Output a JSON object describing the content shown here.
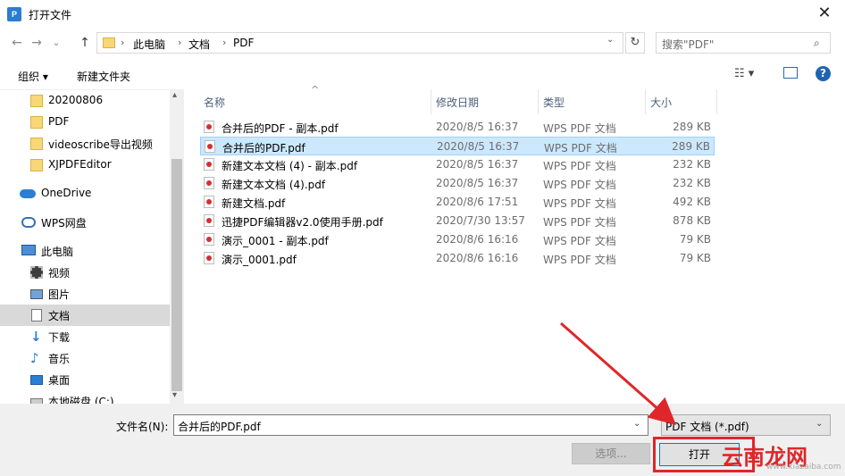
{
  "window": {
    "title": "打开文件",
    "app_icon": "wps-pdf-icon",
    "close_glyph": "✕"
  },
  "nav": {
    "back_glyph": "←",
    "forward_glyph": "→",
    "recent_glyph": "⌄",
    "up_glyph": "↑",
    "breadcrumbs": [
      "此电脑",
      "文档",
      "PDF"
    ],
    "crumb_sep": "›",
    "dropdown_glyph": "⌄",
    "refresh_glyph": "↻",
    "search_placeholder": "搜索\"PDF\"",
    "search_glyph": "⌕"
  },
  "toolbar": {
    "organize": "组织 ▾",
    "new_folder": "新建文件夹",
    "view_glyph": "☷ ▾",
    "help": "?"
  },
  "sidebar": {
    "items": [
      {
        "label": "20200806",
        "icon": "folder-icon"
      },
      {
        "label": "PDF",
        "icon": "folder-icon"
      },
      {
        "label": "videoscribe导出视频",
        "icon": "folder-icon"
      },
      {
        "label": "XJPDFEditor",
        "icon": "folder-icon"
      },
      {
        "label": "OneDrive",
        "icon": "cloud-icon"
      },
      {
        "label": "WPS网盘",
        "icon": "wps-cloud-icon"
      },
      {
        "label": "此电脑",
        "icon": "computer-icon"
      },
      {
        "label": "视频",
        "icon": "video-icon"
      },
      {
        "label": "图片",
        "icon": "picture-icon"
      },
      {
        "label": "文档",
        "icon": "document-icon",
        "selected": true
      },
      {
        "label": "下载",
        "icon": "download-icon"
      },
      {
        "label": "音乐",
        "icon": "music-icon"
      },
      {
        "label": "桌面",
        "icon": "desktop-icon"
      },
      {
        "label": "本地磁盘 (C:)",
        "icon": "drive-icon"
      }
    ],
    "scroll_up": "▴",
    "scroll_down": "▾"
  },
  "columns": {
    "name": "名称",
    "modified": "修改日期",
    "type": "类型",
    "size": "大小",
    "sort_glyph": "^"
  },
  "files": [
    {
      "name": "合并后的PDF - 副本.pdf",
      "modified": "2020/8/5 16:37",
      "type": "WPS PDF 文档",
      "size": "289 KB"
    },
    {
      "name": "合并后的PDF.pdf",
      "modified": "2020/8/5 16:37",
      "type": "WPS PDF 文档",
      "size": "289 KB",
      "selected": true
    },
    {
      "name": "新建文本文档 (4) - 副本.pdf",
      "modified": "2020/8/5 16:37",
      "type": "WPS PDF 文档",
      "size": "232 KB"
    },
    {
      "name": "新建文本文档 (4).pdf",
      "modified": "2020/8/5 16:37",
      "type": "WPS PDF 文档",
      "size": "232 KB"
    },
    {
      "name": "新建文档.pdf",
      "modified": "2020/8/6 17:51",
      "type": "WPS PDF 文档",
      "size": "492 KB"
    },
    {
      "name": "迅捷PDF编辑器v2.0使用手册.pdf",
      "modified": "2020/7/30 13:57",
      "type": "WPS PDF 文档",
      "size": "878 KB"
    },
    {
      "name": "演示_0001 - 副本.pdf",
      "modified": "2020/8/6 16:16",
      "type": "WPS PDF 文档",
      "size": "79 KB"
    },
    {
      "name": "演示_0001.pdf",
      "modified": "2020/8/6 16:16",
      "type": "WPS PDF 文档",
      "size": "79 KB"
    }
  ],
  "footer": {
    "filename_label": "文件名(N):",
    "filename_value": "合并后的PDF.pdf",
    "filetype_value": "PDF 文档 (*.pdf)",
    "dropdown_glyph": "⌄",
    "options_button": "选项...",
    "open_button": "打开"
  },
  "watermark": {
    "brand": "云南龙网",
    "url": "www.xiazaiba.com"
  },
  "colors": {
    "selection": "#cce8ff",
    "annotation_red": "#e0262a",
    "accent": "#0078d7"
  }
}
